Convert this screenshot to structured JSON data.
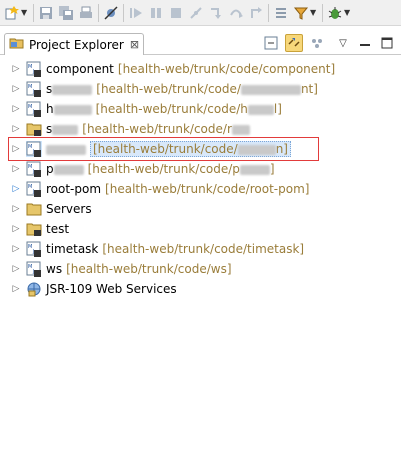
{
  "view": {
    "title": "Project Explorer",
    "close_glyph": "⊠"
  },
  "toolbar_icons": [
    "new-wizard-icon",
    "save-icon",
    "save-all-icon",
    "print-icon",
    "skip-breakpoints-icon",
    "resume-icon",
    "suspend-icon",
    "terminate-icon",
    "disconnect-icon",
    "step-into-icon",
    "step-over-icon",
    "step-return-icon",
    "drop-to-frame-icon",
    "use-step-filters-icon",
    "debug-icon"
  ],
  "tree": [
    {
      "name": "component",
      "path": "[health-web/trunk/code/component]",
      "type": "maven",
      "arrow": "▷"
    },
    {
      "name": "s",
      "path": "[health-web/trunk/code/",
      "path_tail": "nt]",
      "type": "maven",
      "arrow": "▷"
    },
    {
      "name": "h",
      "path": "[health-web/trunk/code/h",
      "path_tail": "l]",
      "type": "maven",
      "arrow": "▷"
    },
    {
      "name": "s",
      "path": "[health-web/trunk/code/r",
      "path_tail": "",
      "type": "folder-proj",
      "arrow": "▷"
    },
    {
      "name": "",
      "path": "[health-web/trunk/code/",
      "path_tail": "n]",
      "type": "maven",
      "arrow": "▷",
      "selected": true
    },
    {
      "name": "p",
      "path": "[health-web/trunk/code/p",
      "path_tail": "]",
      "type": "maven",
      "arrow": "▷"
    },
    {
      "name": "root-pom",
      "path": "[health-web/trunk/code/root-pom]",
      "type": "maven",
      "arrow": "▷",
      "arrow_blue": true
    },
    {
      "name": "Servers",
      "path": "",
      "type": "folder",
      "arrow": "▷"
    },
    {
      "name": "test",
      "path": "",
      "type": "folder-proj",
      "arrow": "▷"
    },
    {
      "name": "timetask",
      "path": "[health-web/trunk/code/timetask]",
      "type": "maven",
      "arrow": "▷"
    },
    {
      "name": "ws",
      "path": "[health-web/trunk/code/ws]",
      "type": "maven",
      "arrow": "▷"
    },
    {
      "name": "JSR-109 Web Services",
      "path": "",
      "type": "webservices",
      "arrow": "▷"
    }
  ]
}
